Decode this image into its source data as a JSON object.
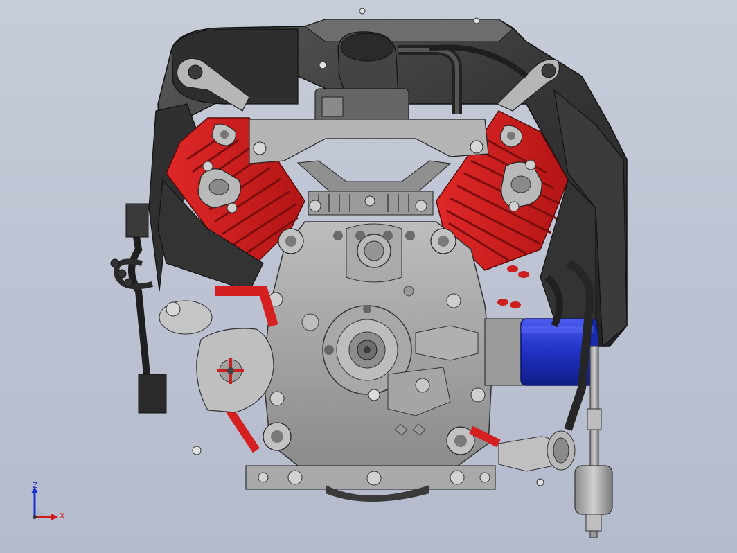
{
  "viewport": {
    "model": "v-twin-engine-assembly",
    "background_top": "#c7ccd9",
    "background_bottom": "#b4bbcc"
  },
  "colors": {
    "cylinder_head": "#d62020",
    "crankcase": "#9c9c9c",
    "shroud": "#3a3a3a",
    "oil_filter": "#1c2fb8",
    "hose": "#2b2b2b",
    "bracket": "#b0b0b0"
  },
  "triad": {
    "z_label": "Z",
    "x_label": "X",
    "z_color": "#1a2fd0",
    "x_color": "#d01a1a"
  }
}
